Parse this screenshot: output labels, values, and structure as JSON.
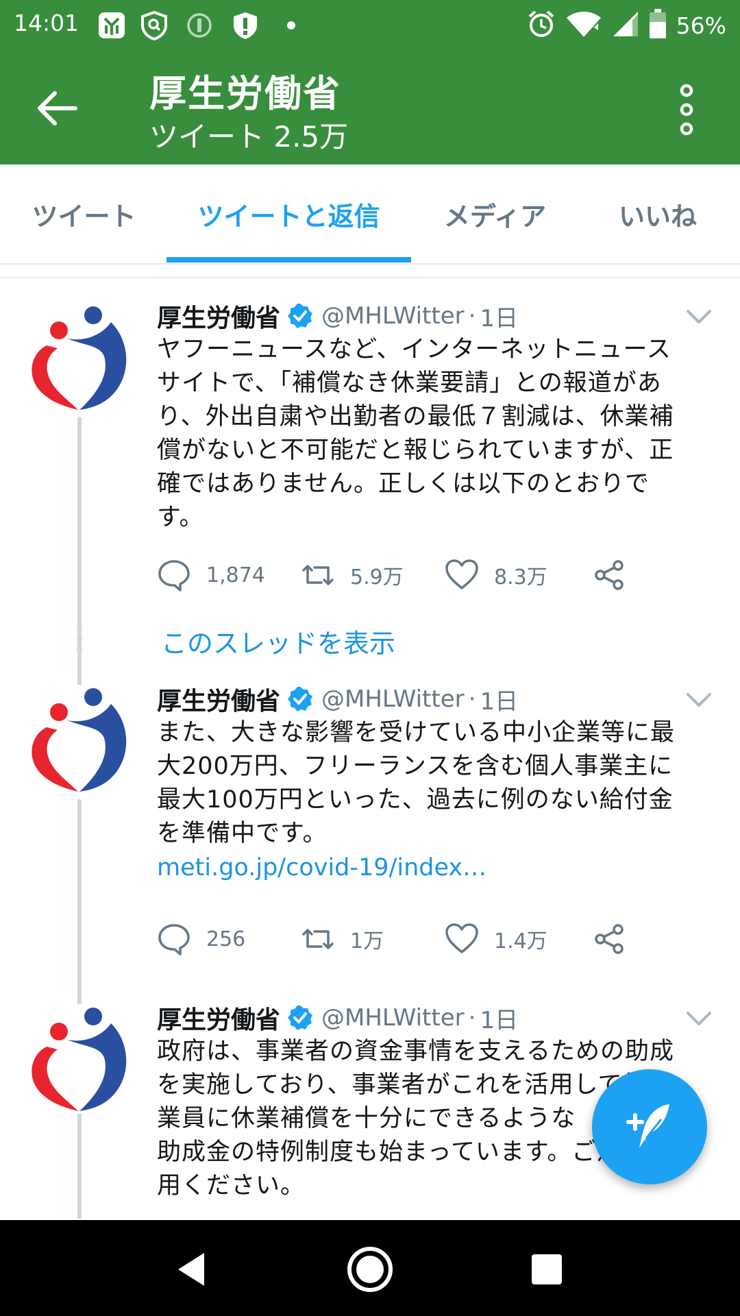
{
  "status_bar": {
    "time": "14:01",
    "battery_percent": "56%",
    "left_icons": [
      "tuxedo-app-icon",
      "shield-search-icon",
      "info-circle-icon",
      "alert-shield-icon",
      "notification-dot-icon"
    ],
    "right_icons": [
      "alarm-icon",
      "wifi-icon",
      "signal-icon",
      "battery-icon"
    ]
  },
  "app_bar": {
    "title": "厚生労働省",
    "subtitle": "ツイート 2.5万"
  },
  "tabs": [
    {
      "label": "ツイート",
      "active": false
    },
    {
      "label": "ツイートと返信",
      "active": true
    },
    {
      "label": "メディア",
      "active": false
    },
    {
      "label": "いいね",
      "active": false
    }
  ],
  "tweets": [
    {
      "author": "厚生労働省",
      "handle": "@MHLWitter",
      "time": "1日",
      "lines": [
        "ヤフーニュースなど、インターネットニュース",
        "サイトで、「補償なき休業要請」との報道があ",
        "り、外出自粛や出勤者の最低７割減は、休業補",
        "償がないと不可能だと報じられていますが、正",
        "確ではありません。正しくは以下のとおりで",
        "す。"
      ],
      "replies": "1,874",
      "retweets": "5.9万",
      "likes": "8.3万"
    },
    {
      "author": "厚生労働省",
      "handle": "@MHLWitter",
      "time": "1日",
      "lines": [
        "また、大きな影響を受けている中小企業等に最",
        "大200万円、フリーランスを含む個人事業主に",
        "最大100万円といった、過去に例のない給付金",
        "を準備中です。"
      ],
      "link": "meti.go.jp/covid-19/index…",
      "replies": "256",
      "retweets": "1万",
      "likes": "1.4万"
    },
    {
      "author": "厚生労働省",
      "handle": "@MHLWitter",
      "time": "1日",
      "lines": [
        "政府は、事業者の資金事情を支えるための助成",
        "を実施しており、事業者がこれを活用して従",
        "業員に休業補償を十分にできるような",
        "助成金の特例制度も始まっています。ご活",
        "用ください。"
      ]
    }
  ],
  "show_thread_label": "このスレッドを表示",
  "colors": {
    "app_green": "#388e3c",
    "twitter_blue": "#1da1f2",
    "link_blue": "#1b95e0",
    "text_dark": "#14171a",
    "text_gray": "#657786",
    "logo_red": "#e8252f",
    "logo_blue": "#2a4fa0"
  },
  "icons": {
    "back": "arrow-left-icon",
    "more": "more-vertical-icon",
    "verified": "verified-badge-icon",
    "caret": "chevron-down-icon",
    "reply": "reply-bubble-icon",
    "retweet": "retweet-icon",
    "like": "heart-icon",
    "share": "share-icon",
    "compose": "compose-feather-icon",
    "nav": [
      "nav-back-icon",
      "nav-home-icon",
      "nav-recents-icon"
    ]
  }
}
